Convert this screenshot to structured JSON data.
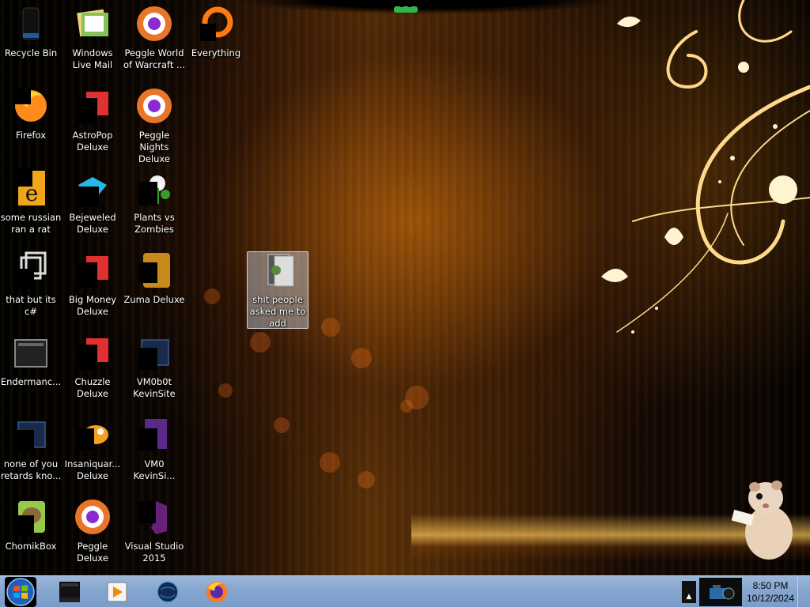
{
  "desktop": {
    "icons": [
      {
        "label": "Recycle Bin",
        "icon": "recycle-bin-icon"
      },
      {
        "label": "Windows Live Mail",
        "icon": "mail-icon"
      },
      {
        "label": "Peggle World of Warcraft ...",
        "icon": "peggle-icon"
      },
      {
        "label": "Everything",
        "icon": "search-tool-icon"
      },
      {
        "label": "Firefox",
        "icon": "firefox-icon"
      },
      {
        "label": "AstroPop Deluxe",
        "icon": "game-icon"
      },
      {
        "label": "Peggle Nights Deluxe",
        "icon": "peggle-icon"
      },
      {
        "label": "some russian ran a rat",
        "icon": "text-file-icon"
      },
      {
        "label": "Bejeweled Deluxe",
        "icon": "gem-icon"
      },
      {
        "label": "Plants vs Zombies",
        "icon": "plant-icon"
      },
      {
        "label": "that but its c#",
        "icon": "shortcut-icon"
      },
      {
        "label": "Big Money Deluxe",
        "icon": "game-icon"
      },
      {
        "label": "Zuma Deluxe",
        "icon": "zuma-icon"
      },
      {
        "label": "Endermanc...",
        "icon": "window-icon"
      },
      {
        "label": "Chuzzle Deluxe",
        "icon": "game-icon"
      },
      {
        "label": "VM0b0t KevinSite",
        "icon": "program-icon"
      },
      {
        "label": "none of you retards kno...",
        "icon": "program-icon"
      },
      {
        "label": "Insaniquar... Deluxe",
        "icon": "fish-icon"
      },
      {
        "label": "VM0 KevinSi...",
        "icon": "visual-studio-project-icon"
      },
      {
        "label": "ChomikBox",
        "icon": "hamster-icon"
      },
      {
        "label": "Peggle Deluxe",
        "icon": "peggle-icon"
      },
      {
        "label": "Visual Studio 2015",
        "icon": "visual-studio-icon"
      },
      {
        "label": "shit people asked me to add",
        "icon": "folder-icon"
      }
    ]
  },
  "taskbar": {
    "pinned": [
      {
        "icon": "command-prompt-icon"
      },
      {
        "icon": "media-player-icon"
      },
      {
        "icon": "globe-icon"
      },
      {
        "icon": "firefox-icon"
      }
    ],
    "tray_arrow": "▲",
    "clock_time": "8:50 PM",
    "clock_date": "10/12/2024"
  },
  "colors": {
    "taskbar": "#86a6cf",
    "accent_orange": "#f0a020"
  }
}
